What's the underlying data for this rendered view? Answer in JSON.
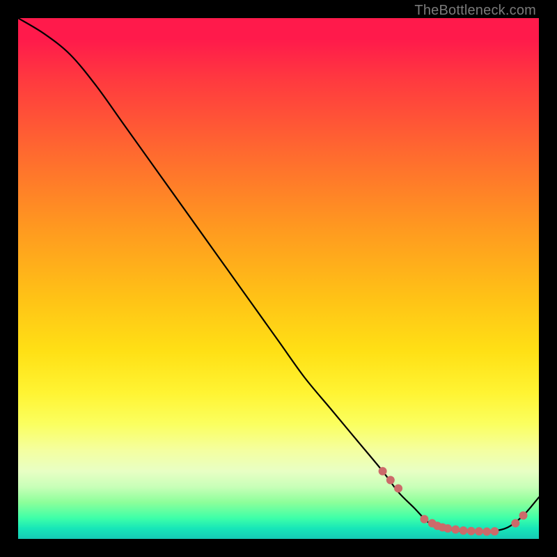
{
  "watermark": "TheBottleneck.com",
  "chart_data": {
    "type": "line",
    "title": "",
    "xlabel": "",
    "ylabel": "",
    "xlim": [
      0,
      100
    ],
    "ylim": [
      0,
      100
    ],
    "series": [
      {
        "name": "bottleneck-curve",
        "x": [
          0,
          5,
          10,
          15,
          20,
          25,
          30,
          35,
          40,
          45,
          50,
          55,
          60,
          65,
          70,
          73,
          76,
          79,
          82,
          85,
          88,
          91,
          94,
          97,
          100
        ],
        "y": [
          100,
          97,
          93,
          87,
          80,
          73,
          66,
          59,
          52,
          45,
          38,
          31,
          25,
          19,
          13,
          9,
          6,
          3,
          2,
          1.5,
          1.4,
          1.5,
          2.2,
          4.5,
          8
        ]
      }
    ],
    "marker_points": {
      "name": "curve-dots",
      "color": "#cc6a6a",
      "x": [
        70,
        71.5,
        73,
        78,
        79.5,
        80.5,
        81.5,
        82.5,
        84,
        85.5,
        87,
        88.5,
        90,
        91.5,
        95.5,
        97
      ],
      "y": [
        13,
        11.3,
        9.7,
        3.8,
        3.0,
        2.5,
        2.2,
        2.0,
        1.8,
        1.6,
        1.5,
        1.45,
        1.4,
        1.45,
        3.0,
        4.5
      ]
    }
  }
}
